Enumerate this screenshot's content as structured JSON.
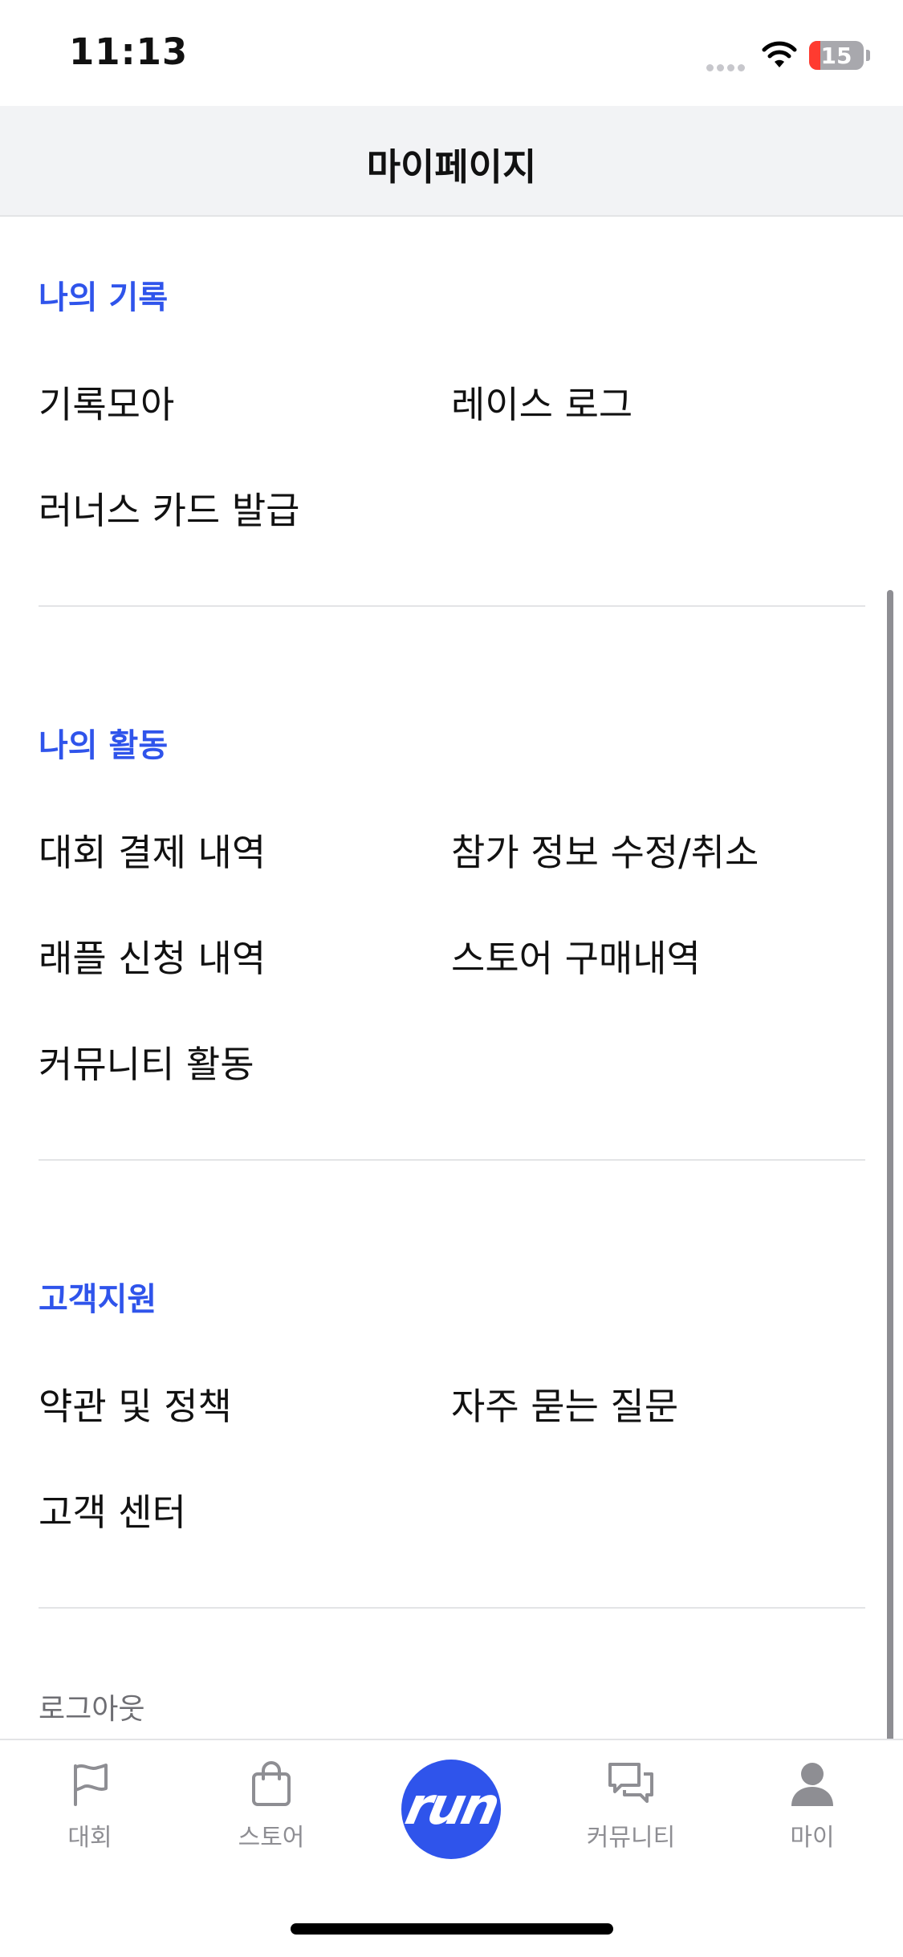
{
  "status_bar": {
    "time": "11:13",
    "battery": "15"
  },
  "header": {
    "title": "마이페이지"
  },
  "sections": [
    {
      "title": "나의 기록",
      "items": [
        "기록모아",
        "레이스 로그",
        "러너스 카드 발급"
      ]
    },
    {
      "title": "나의 활동",
      "items": [
        "대회 결제 내역",
        "참가 정보 수정/취소",
        "래플 신청 내역",
        "스토어 구매내역",
        "커뮤니티 활동"
      ]
    },
    {
      "title": "고객지원",
      "items": [
        "약관 및 정책",
        "자주 묻는 질문",
        "고객 센터"
      ]
    }
  ],
  "logout_label": "로그아웃",
  "tab_bar": {
    "tabs": [
      {
        "label": "대회",
        "icon": "flag-icon"
      },
      {
        "label": "스토어",
        "icon": "shopping-bag-icon"
      },
      {
        "label": "run",
        "icon": "run-logo"
      },
      {
        "label": "커뮤니티",
        "icon": "chat-bubbles-icon"
      },
      {
        "label": "마이",
        "icon": "person-icon"
      }
    ],
    "center_button_text": "run",
    "accent_color": "#2f54eb",
    "inactive_color": "#8e8e93"
  }
}
